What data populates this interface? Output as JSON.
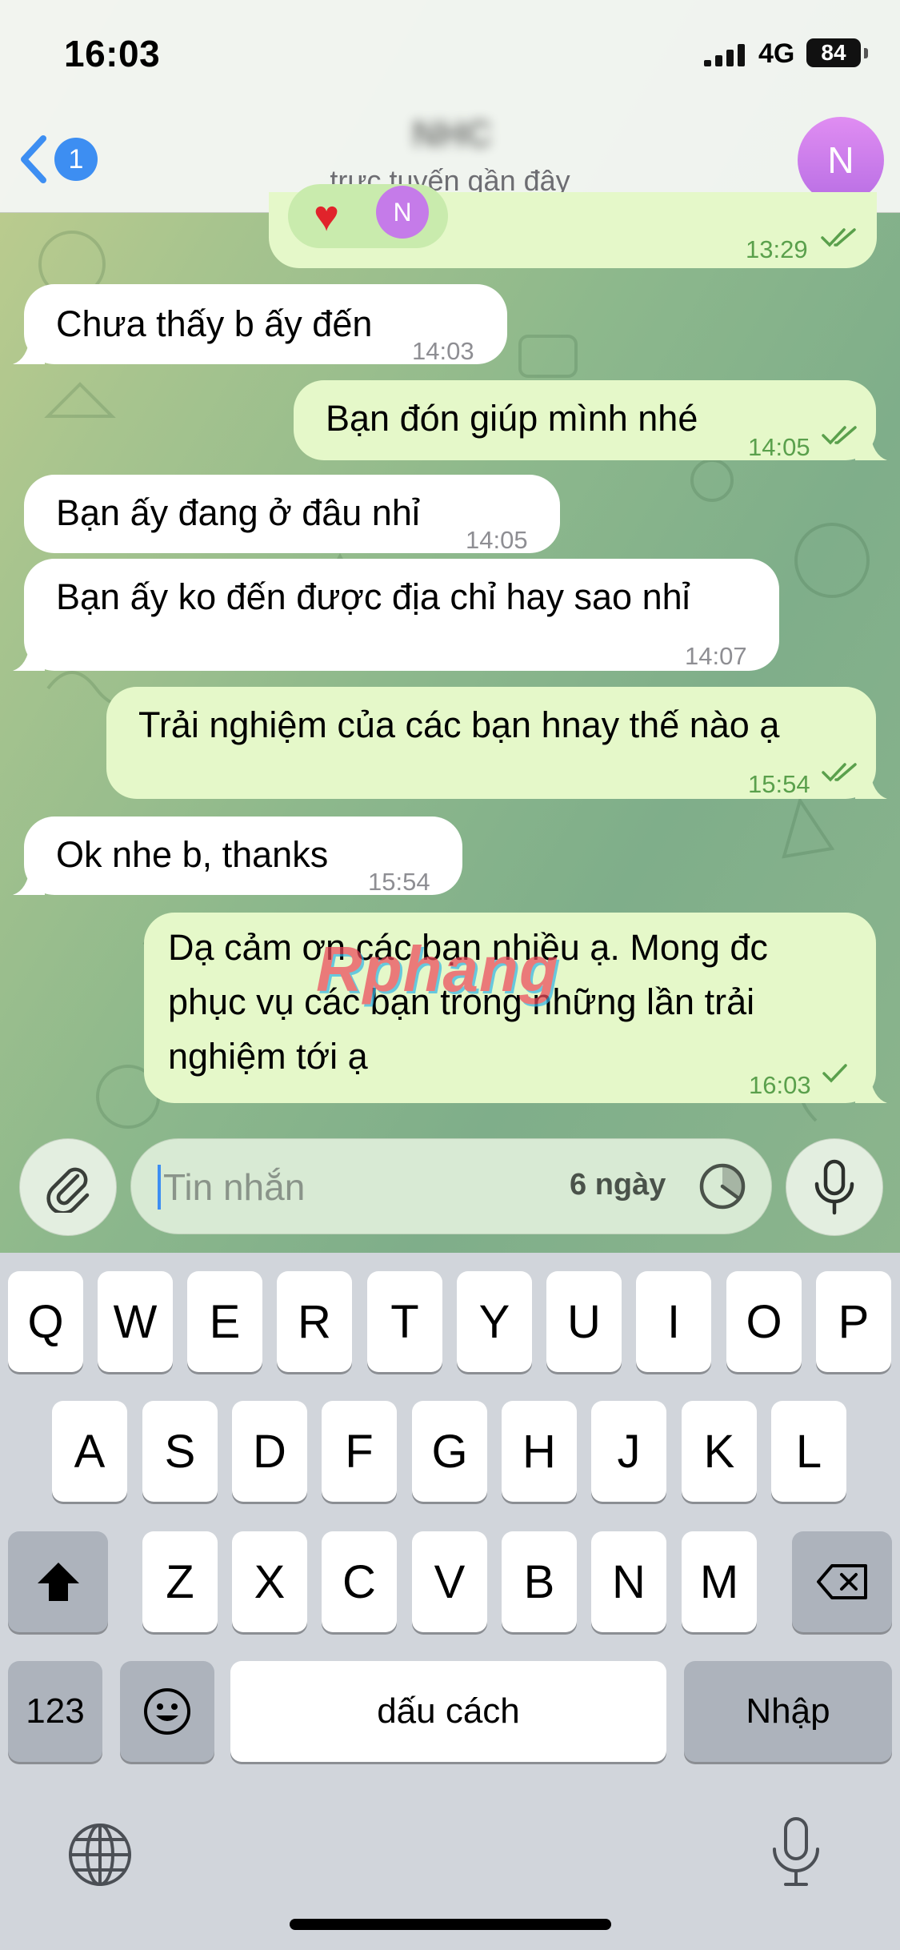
{
  "status_bar": {
    "time": "16:03",
    "network": "4G",
    "battery": "84"
  },
  "header": {
    "back_count": "1",
    "contact_status": "trực tuyến gần đây",
    "avatar_initial": "N"
  },
  "reaction": {
    "emoji": "♥",
    "avatar_initial": "N",
    "time": "13:29"
  },
  "messages": [
    {
      "dir": "in",
      "text": "Chưa thấy b ấy đến",
      "time": "14:03"
    },
    {
      "dir": "out",
      "text": "Bạn đón giúp mình nhé",
      "time": "14:05"
    },
    {
      "dir": "in",
      "text": "Bạn ấy đang ở đâu nhỉ",
      "time": "14:05"
    },
    {
      "dir": "in",
      "text": "Bạn ấy ko đến được địa chỉ hay sao nhỉ",
      "time": "14:07"
    },
    {
      "dir": "out",
      "text": "Trải nghiệm của các bạn hnay thế nào ạ",
      "time": "15:54"
    },
    {
      "dir": "in",
      "text": "Ok nhe b, thanks",
      "time": "15:54"
    },
    {
      "dir": "out",
      "lines": [
        "Dạ cảm ơn các bạn nhiều ạ. Mong đc",
        "phục vụ các bạn trong những lần trải",
        "nghiệm tới ạ"
      ],
      "time": "16:03"
    }
  ],
  "watermark": "Rphang",
  "input": {
    "placeholder": "Tin nhắn",
    "timer_label": "6 ngày"
  },
  "keyboard": {
    "row1": [
      "Q",
      "W",
      "E",
      "R",
      "T",
      "Y",
      "U",
      "I",
      "O",
      "P"
    ],
    "row2": [
      "A",
      "S",
      "D",
      "F",
      "G",
      "H",
      "J",
      "K",
      "L"
    ],
    "row3": [
      "Z",
      "X",
      "C",
      "V",
      "B",
      "N",
      "M"
    ],
    "numbers_label": "123",
    "space_label": "dấu cách",
    "return_label": "Nhập"
  },
  "colors": {
    "accent": "#3d8ef2",
    "outgoing_bubble": "#e5f8c9",
    "incoming_bubble": "#ffffff",
    "avatar": "#c57be9"
  }
}
